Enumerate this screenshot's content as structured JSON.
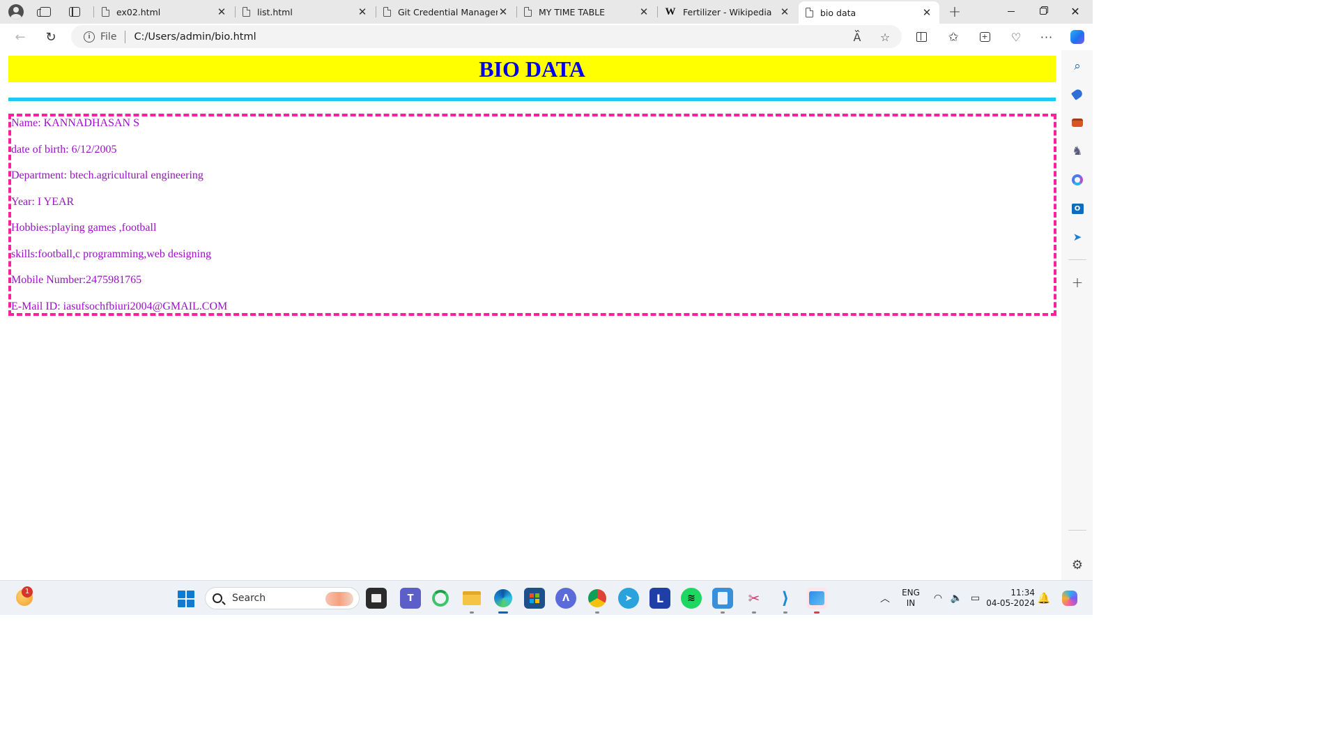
{
  "browser": {
    "tabs": [
      {
        "title": "ex02.html",
        "icon": "file-icon"
      },
      {
        "title": "list.html",
        "icon": "file-icon"
      },
      {
        "title": "Git Credential Manager -",
        "icon": "file-icon"
      },
      {
        "title": "MY TIME TABLE",
        "icon": "file-icon"
      },
      {
        "title": "Fertilizer - Wikipedia",
        "icon": "wikipedia-icon"
      },
      {
        "title": "bio data",
        "icon": "file-icon",
        "active": true
      }
    ],
    "tab_close_glyph": "✕",
    "new_tab_glyph": "+",
    "address": {
      "scheme_label": "File",
      "url": "C:/Users/admin/bio.html"
    }
  },
  "page": {
    "heading": "BIO DATA",
    "heading_bg": "#ffff00",
    "heading_color": "#0000ee",
    "rule_color": "#1ec7f5",
    "box_border_color": "#ff1f9f",
    "text_color": "#9b10c7",
    "lines": [
      "Name: KANNADHASAN S",
      "date of birth: 6/12/2005",
      "Department: btech.agricultural engineering",
      "Year: I YEAR",
      "Hobbies:playing games ,football",
      "skills:football,c programming,web designing",
      "Mobile Number:2475981765",
      "E-Mail ID: iasufsochfbiuri2004@GMAIL.COM"
    ]
  },
  "taskbar": {
    "search_label": "Search",
    "notification_count": "1",
    "language": {
      "top": "ENG",
      "bottom": "IN"
    },
    "time": "11:34",
    "date": "04-05-2024"
  }
}
